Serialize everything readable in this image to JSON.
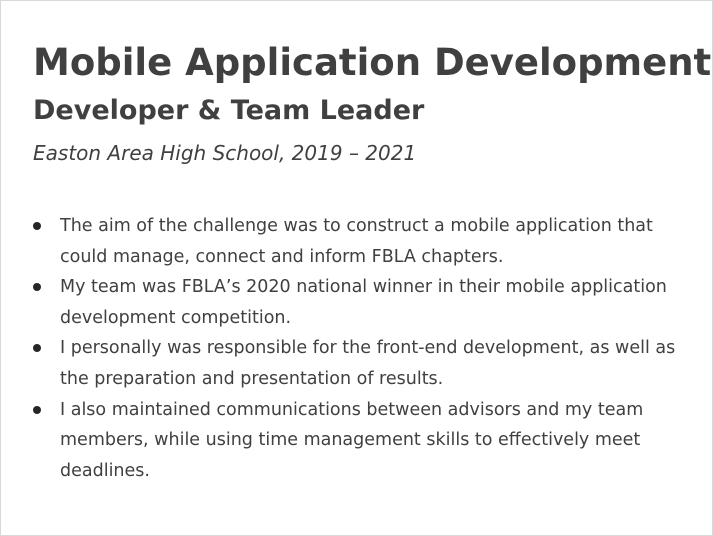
{
  "heading": {
    "title": "Mobile Application Development",
    "role": "Developer & Team Leader",
    "organization": "Easton Area High School, 2019 – 2021"
  },
  "bullets": [
    "The aim of the challenge was to construct a mobile application that could manage, connect and inform FBLA chapters.",
    "My team was FBLA’s 2020 national winner in their mobile application development competition.",
    "I personally was responsible for the front-end development, as well as the preparation and presentation of results.",
    "I also maintained communications between advisors and my team members, while using time management skills to effectively meet deadlines."
  ],
  "colors": {
    "text": "#404040",
    "border": "#d9d9d9",
    "bullet": "#262626"
  }
}
